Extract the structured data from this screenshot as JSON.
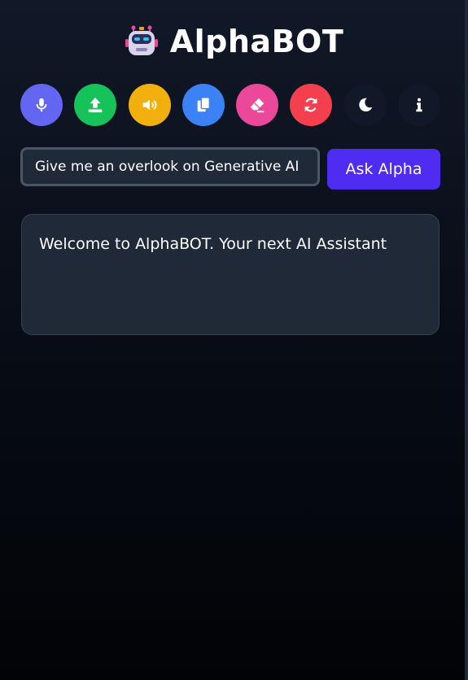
{
  "app": {
    "title": "AlphaBOT",
    "logo_icon": "robot-icon"
  },
  "toolbar": {
    "buttons": [
      {
        "name": "microphone",
        "icon": "microphone-icon",
        "color": "#6366f1"
      },
      {
        "name": "upload",
        "icon": "upload-icon",
        "color": "#16c25a"
      },
      {
        "name": "speaker",
        "icon": "volume-icon",
        "color": "#f2b00f"
      },
      {
        "name": "copy",
        "icon": "copy-icon",
        "color": "#3b82f6"
      },
      {
        "name": "erase",
        "icon": "eraser-icon",
        "color": "#ec4899"
      },
      {
        "name": "refresh",
        "icon": "refresh-icon",
        "color": "#f43f4e"
      },
      {
        "name": "dark-mode",
        "icon": "moon-icon",
        "color": "#111827"
      },
      {
        "name": "info",
        "icon": "info-icon",
        "color": "#111827"
      }
    ]
  },
  "query": {
    "value": "Give me an overlook on Generative AI",
    "button_label": "Ask Alpha"
  },
  "response": {
    "text": "Welcome to AlphaBOT. Your next AI Assistant"
  }
}
